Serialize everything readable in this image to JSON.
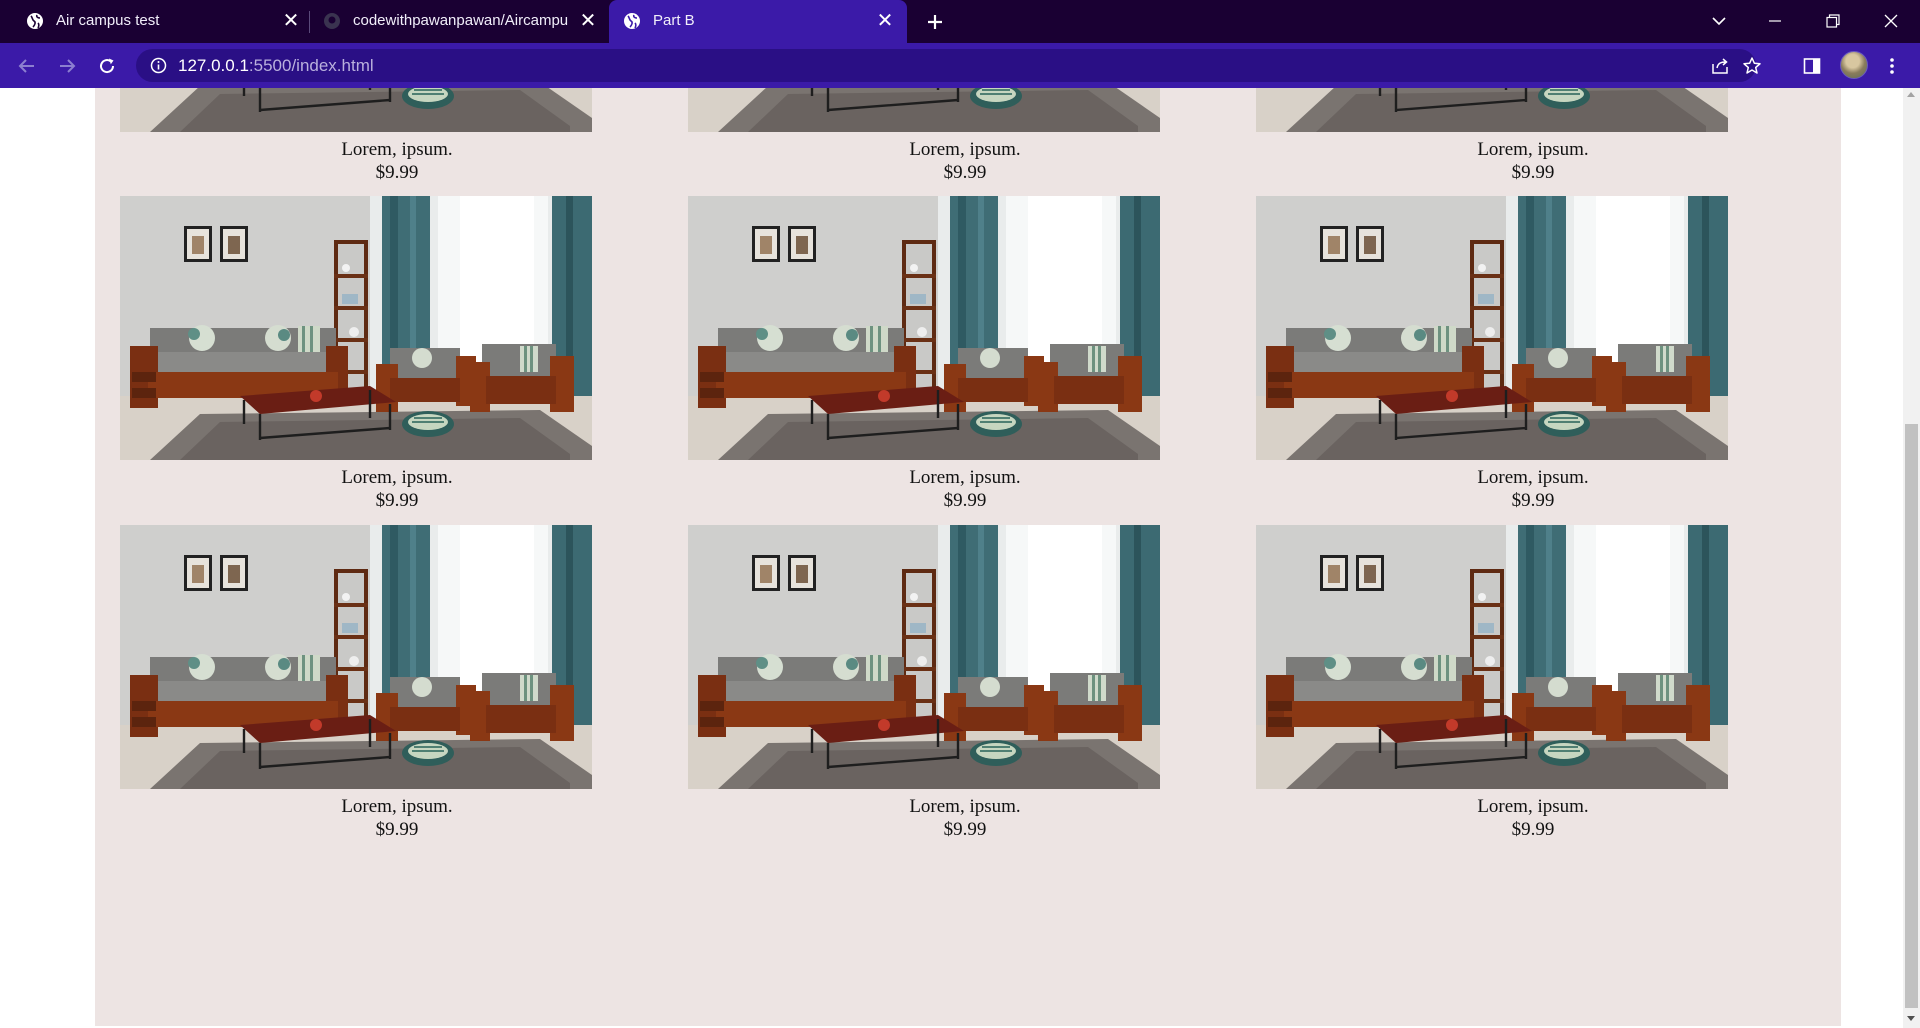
{
  "browser": {
    "tabs": [
      {
        "title": "Air campus test",
        "active": false,
        "icon": "globe-icon"
      },
      {
        "title": "codewithpawanpawan/Aircampu",
        "active": false,
        "icon": "github-icon"
      },
      {
        "title": "Part B",
        "active": true,
        "icon": "globe-icon"
      }
    ],
    "url_host": "127.0.0.1",
    "url_rest": ":5500/index.html",
    "colors": {
      "tabbar": "#1a0033",
      "toolbar": "#3b1aa8",
      "omnibox": "#2a0f85"
    }
  },
  "products": [
    {
      "name": "Lorem, ipsum.",
      "price": "$9.99"
    },
    {
      "name": "Lorem, ipsum.",
      "price": "$9.99"
    },
    {
      "name": "Lorem, ipsum.",
      "price": "$9.99"
    },
    {
      "name": "Lorem, ipsum.",
      "price": "$9.99"
    },
    {
      "name": "Lorem, ipsum.",
      "price": "$9.99"
    },
    {
      "name": "Lorem, ipsum.",
      "price": "$9.99"
    },
    {
      "name": "Lorem, ipsum.",
      "price": "$9.99"
    },
    {
      "name": "Lorem, ipsum.",
      "price": "$9.99"
    },
    {
      "name": "Lorem, ipsum.",
      "price": "$9.99"
    }
  ],
  "page_colors": {
    "panel": "#ede4e3"
  }
}
